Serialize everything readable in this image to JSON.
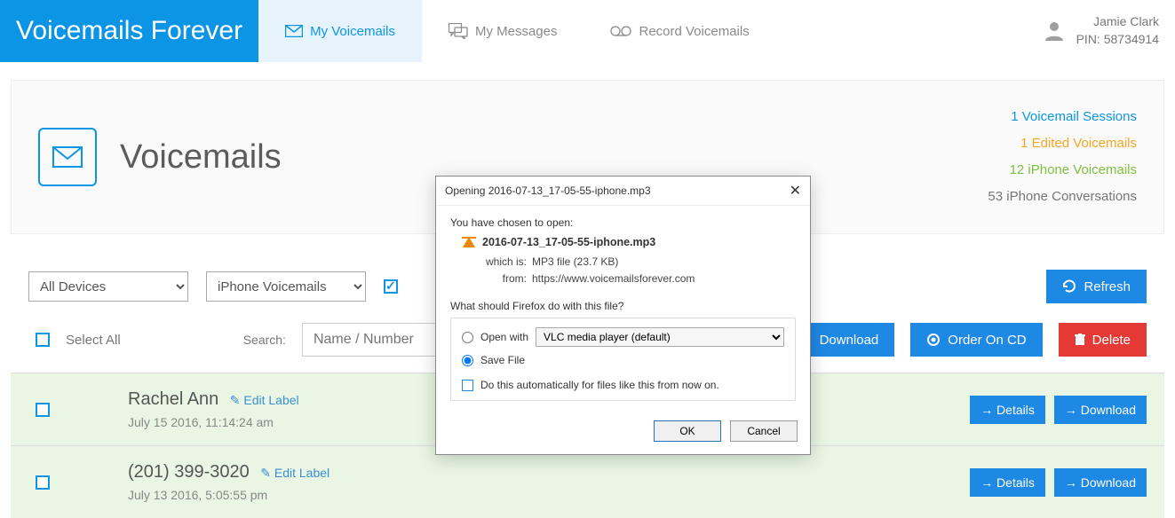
{
  "logo": "Voicemails Forever",
  "nav": {
    "voicemails": "My Voicemails",
    "messages": "My Messages",
    "record": "Record Voicemails"
  },
  "account": {
    "name": "Jamie Clark",
    "pin": "PIN: 58734914"
  },
  "header": {
    "title": "Voicemails",
    "stats": {
      "sessions": "1 Voicemail Sessions",
      "edited": "1 Edited Voicemails",
      "iphone_vm": "12 iPhone Voicemails",
      "iphone_conv": "53 iPhone Conversations"
    }
  },
  "filters": {
    "device": "All Devices",
    "type": "iPhone Voicemails",
    "refresh": "Refresh"
  },
  "actions": {
    "select_all": "Select All",
    "search_label": "Search:",
    "search_placeholder": "Name / Number",
    "download": "Download",
    "order_cd": "Order On CD",
    "delete": "Delete"
  },
  "rows": [
    {
      "name": "Rachel Ann",
      "edit": "Edit Label",
      "date": "July 15 2016, 11:14:24 am",
      "details": "→ Details",
      "download": "→ Download"
    },
    {
      "name": "(201) 399-3020",
      "edit": "Edit Label",
      "date": "July 13 2016, 5:05:55 pm",
      "details": "→ Details",
      "download": "→ Download"
    }
  ],
  "dialog": {
    "title": "Opening 2016-07-13_17-05-55-iphone.mp3",
    "intro": "You have chosen to open:",
    "filename": "2016-07-13_17-05-55-iphone.mp3",
    "which_is_k": "which is:",
    "which_is_v": "MP3 file (23.7 KB)",
    "from_k": "from:",
    "from_v": "https://www.voicemailsforever.com",
    "question": "What should Firefox do with this file?",
    "open_with": "Open with",
    "app": "VLC media player (default)",
    "save_file": "Save File",
    "auto": "Do this automatically for files like this from now on.",
    "ok": "OK",
    "cancel": "Cancel"
  }
}
